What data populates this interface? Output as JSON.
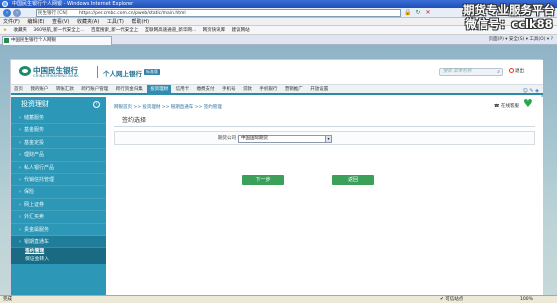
{
  "browser": {
    "title": "中国民生银行个人网银 - Windows Internet Explorer",
    "address": "https://per.cmbc.com.cn/pweb/static/main.html",
    "address_prefix": "民生银行 [CN]",
    "menu": [
      "文件(F)",
      "编辑(E)",
      "查看(V)",
      "收藏夹(A)",
      "工具(T)",
      "帮助(H)"
    ],
    "favorites": [
      "收藏夹",
      "360导航_新一代安全上...",
      "百度搜索_新一代安全上",
      "互联网高速通道_新华网...",
      "网页快讯库",
      "建议网站"
    ],
    "tab_title": "中国民生银行个人网银",
    "tools_right": "页面(P) ▾  安全(S) ▾  工具(O) ▾  ?",
    "status_left": "完成",
    "status_zone": "可信站点",
    "status_zoom": "100%"
  },
  "watermark": {
    "line1": "期货专业服务平台",
    "line2": "微信号：cclk88"
  },
  "header": {
    "logo_cn": "中国民生银行",
    "logo_en": "CHINA MINSHENG BANK",
    "site_name": "个人网上银行",
    "version_badge": "标准版",
    "search_placeholder": "搜索 菜单名称",
    "logout": "退出"
  },
  "main_nav": {
    "items": [
      "首页",
      "我的账户",
      "转账汇款",
      "跨行账户管理",
      "跨行资金归集",
      "投资理财",
      "信用卡",
      "缴费支付",
      "手机号",
      "贷款",
      "手机银行",
      "营销推广",
      "开放设置"
    ],
    "active_index": 5
  },
  "sidebar": {
    "title": "投资理财",
    "items": [
      "储蓄服务",
      "基金服务",
      "基金定投",
      "理财产品",
      "私人银行产品",
      "代销信托管理",
      "保险",
      "网上证券",
      "外汇买卖",
      "贵金属服务",
      "银期直通车"
    ],
    "open_index": 10,
    "sub_items": [
      "签约管理",
      "保证金转入"
    ],
    "active_sub_index": 0
  },
  "content": {
    "breadcrumb": "网银首页 >> 投资理财 >> 银期直通车 >> 签约管理",
    "online_help": "在线客服",
    "panel_title": "签约选择",
    "form_label": "期货公司 公司",
    "select_value": "中国国际期货",
    "next_button": "下一步",
    "back_button": "返回"
  },
  "colors": {
    "brand_teal": "#2c97b6",
    "button_green": "#3aa05a"
  }
}
